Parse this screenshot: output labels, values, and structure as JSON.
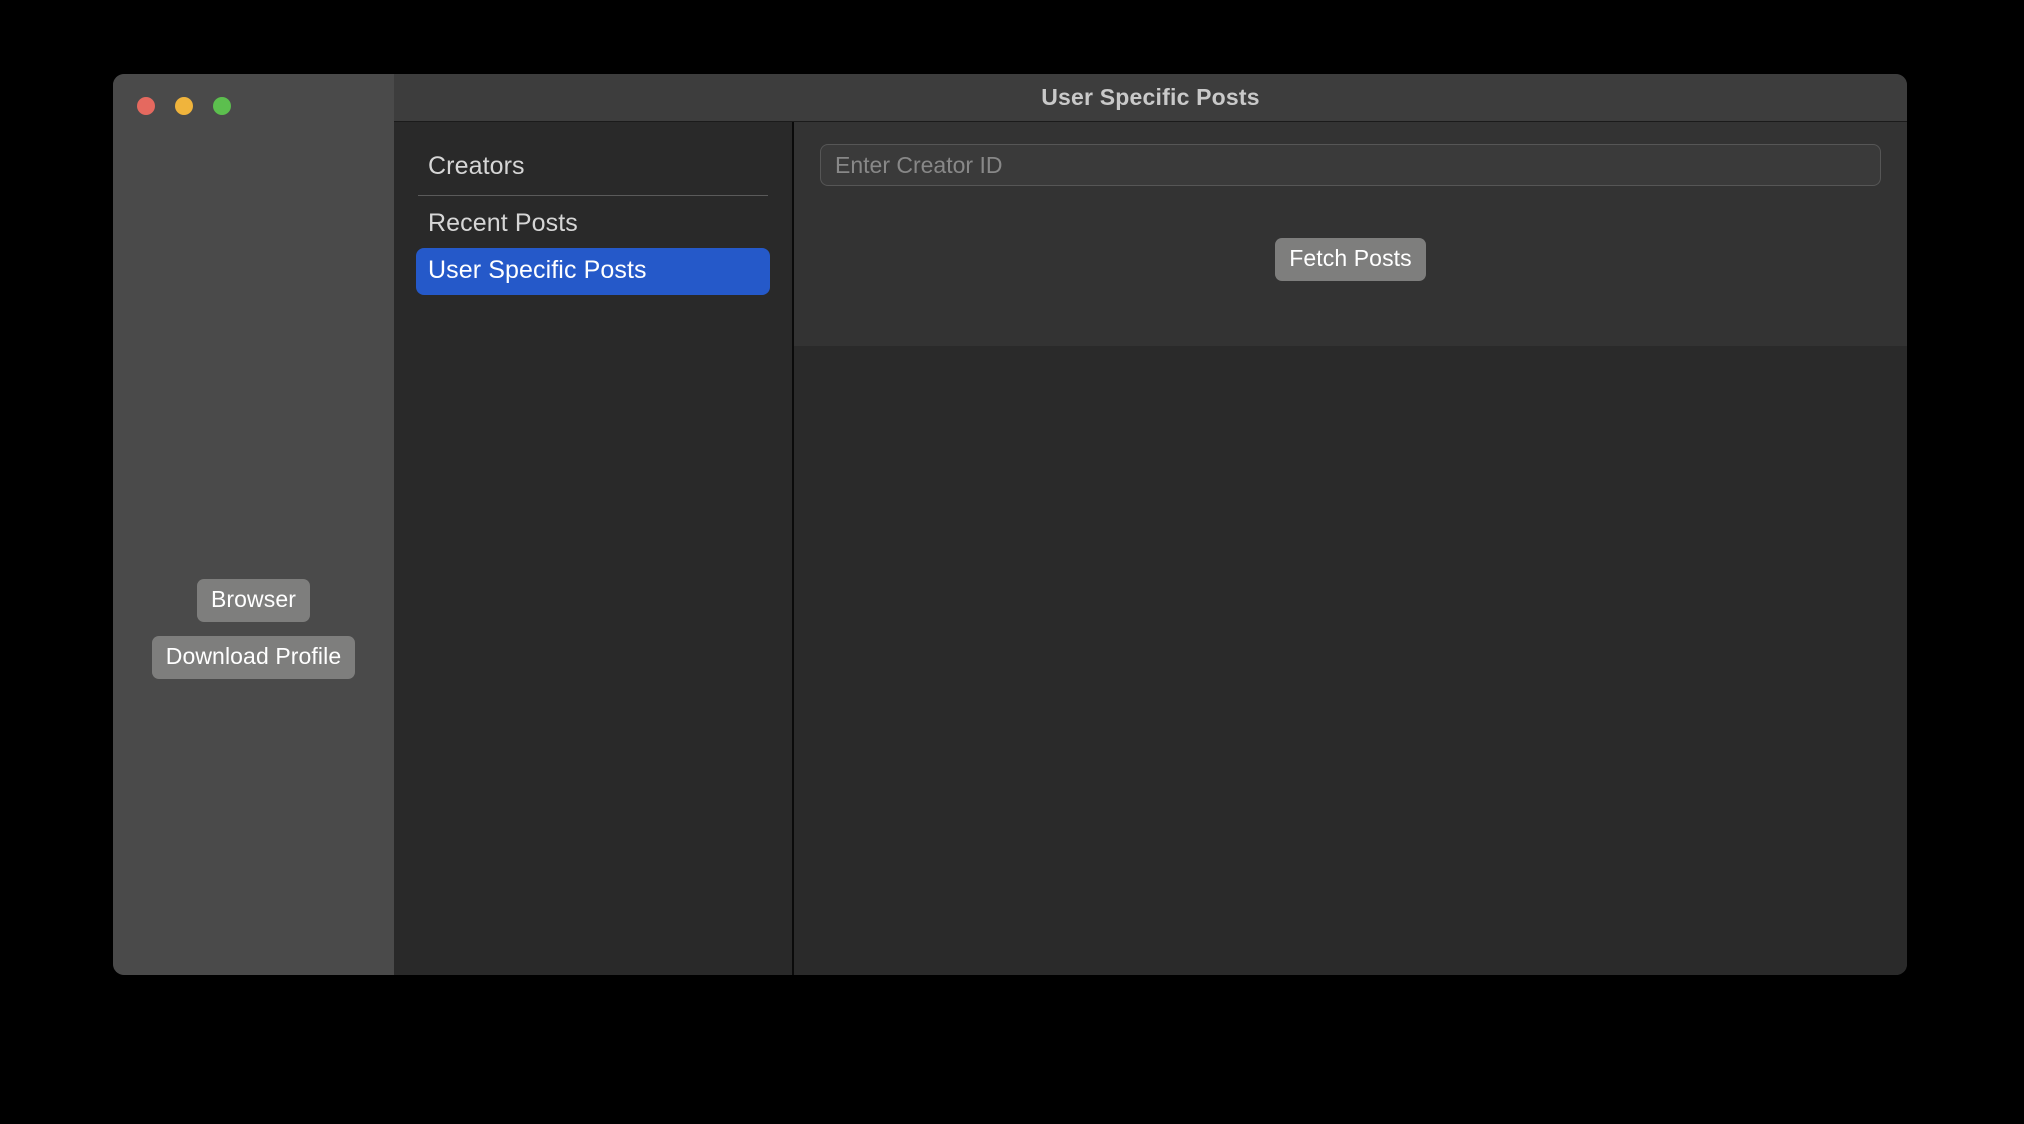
{
  "window": {
    "title": "User Specific Posts",
    "traffic_lights": [
      {
        "name": "close",
        "color": "#e5695f"
      },
      {
        "name": "minimize",
        "color": "#f0b43c"
      },
      {
        "name": "maximize",
        "color": "#5cbf4e"
      }
    ]
  },
  "left_panel": {
    "buttons": [
      {
        "label": "Browser"
      },
      {
        "label": "Download Profile"
      }
    ]
  },
  "sidebar": {
    "items": [
      {
        "label": "Creators",
        "selected": false
      },
      {
        "label": "Recent Posts",
        "selected": false
      },
      {
        "label": "User Specific Posts",
        "selected": true
      }
    ]
  },
  "main": {
    "creator_id_input": {
      "value": "",
      "placeholder": "Enter Creator ID"
    },
    "fetch_button": {
      "label": "Fetch Posts"
    },
    "results": {
      "items": []
    }
  },
  "colors": {
    "accent": "#2559c9",
    "window_chrome": "#3d3d3d",
    "left_panel": "#4a4a4a",
    "sidebar": "#292929",
    "form_area": "#333333",
    "results_area": "#2a2a2a",
    "button_gray": "#7e7e7d"
  }
}
